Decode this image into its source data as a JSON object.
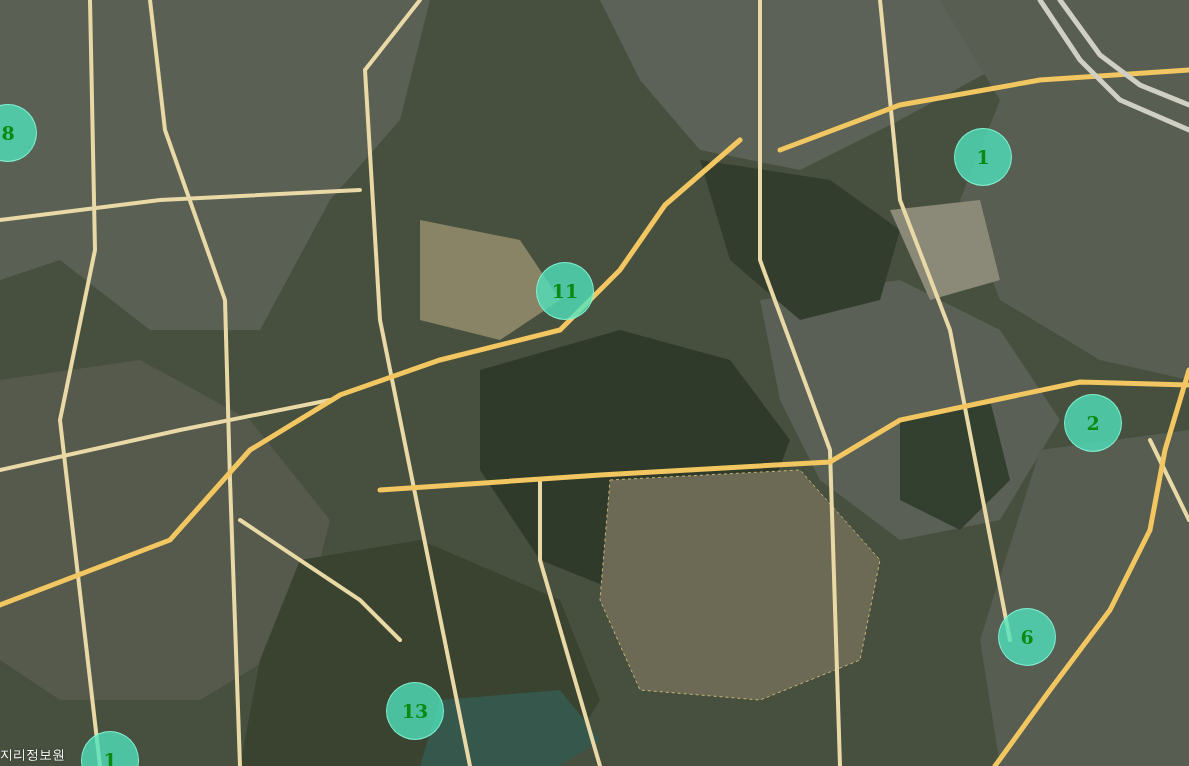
{
  "map": {
    "attribution": "지리정보원"
  },
  "clusters": [
    {
      "count": "8"
    },
    {
      "count": "1"
    },
    {
      "count": "11"
    },
    {
      "count": "2"
    },
    {
      "count": "6"
    },
    {
      "count": "13"
    },
    {
      "count": "1"
    }
  ]
}
